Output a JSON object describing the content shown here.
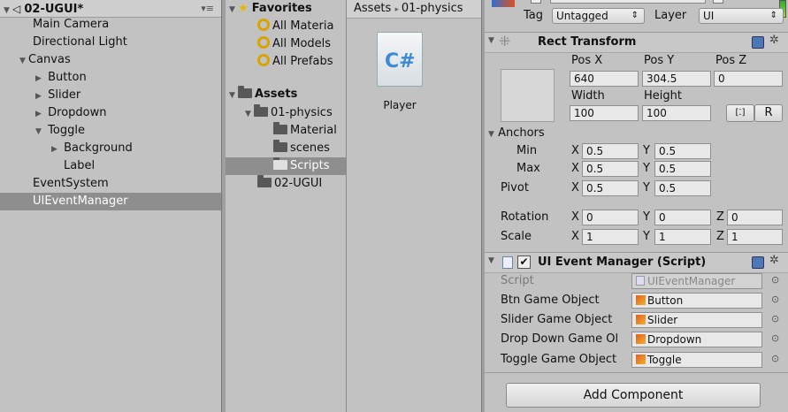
{
  "hierarchy": {
    "scene": "02-UGUI*",
    "items": [
      {
        "label": "Main Camera"
      },
      {
        "label": "Directional Light"
      },
      {
        "label": "Canvas"
      },
      {
        "label": "Button"
      },
      {
        "label": "Slider"
      },
      {
        "label": "Dropdown"
      },
      {
        "label": "Toggle"
      },
      {
        "label": "Background"
      },
      {
        "label": "Label"
      },
      {
        "label": "EventSystem"
      },
      {
        "label": "UIEventManager"
      }
    ]
  },
  "project": {
    "favorites_label": "Favorites",
    "favorites": [
      "All Materia",
      "All Models",
      "All Prefabs"
    ],
    "assets_label": "Assets",
    "folders": [
      "01-physics",
      "Material",
      "scenes",
      "Scripts",
      "02-UGUI"
    ],
    "breadcrumb": [
      "Assets",
      "01-physics"
    ],
    "file": {
      "label": "Player",
      "glyph": "C#"
    }
  },
  "inspector": {
    "tag_label": "Tag",
    "tag_value": "Untagged",
    "layer_label": "Layer",
    "layer_value": "UI",
    "rect_transform": {
      "title": "Rect Transform",
      "pos_x_label": "Pos X",
      "pos_y_label": "Pos Y",
      "pos_z_label": "Pos Z",
      "pos_x": "640",
      "pos_y": "304.5",
      "pos_z": "0",
      "width_label": "Width",
      "height_label": "Height",
      "width": "100",
      "height": "100",
      "r_button": "R",
      "anchors_label": "Anchors",
      "min_label": "Min",
      "max_label": "Max",
      "min_x": "0.5",
      "min_y": "0.5",
      "max_x": "0.5",
      "max_y": "0.5",
      "pivot_label": "Pivot",
      "pivot_x": "0.5",
      "pivot_y": "0.5",
      "rotation_label": "Rotation",
      "rot_x": "0",
      "rot_y": "0",
      "rot_z": "0",
      "scale_label": "Scale",
      "scale_x": "1",
      "scale_y": "1",
      "scale_z": "1",
      "x": "X",
      "y": "Y",
      "z": "Z"
    },
    "script_component": {
      "title": "UI Event Manager (Script)",
      "script_label": "Script",
      "script_value": "UIEventManager",
      "btn_label": "Btn Game Object",
      "btn_value": "Button",
      "slider_label": "Slider Game Object",
      "slider_value": "Slider",
      "dropdown_label": "Drop Down Game Ol",
      "dropdown_value": "Dropdown",
      "toggle_label": "Toggle Game Object",
      "toggle_value": "Toggle"
    },
    "add_component": "Add Component"
  }
}
